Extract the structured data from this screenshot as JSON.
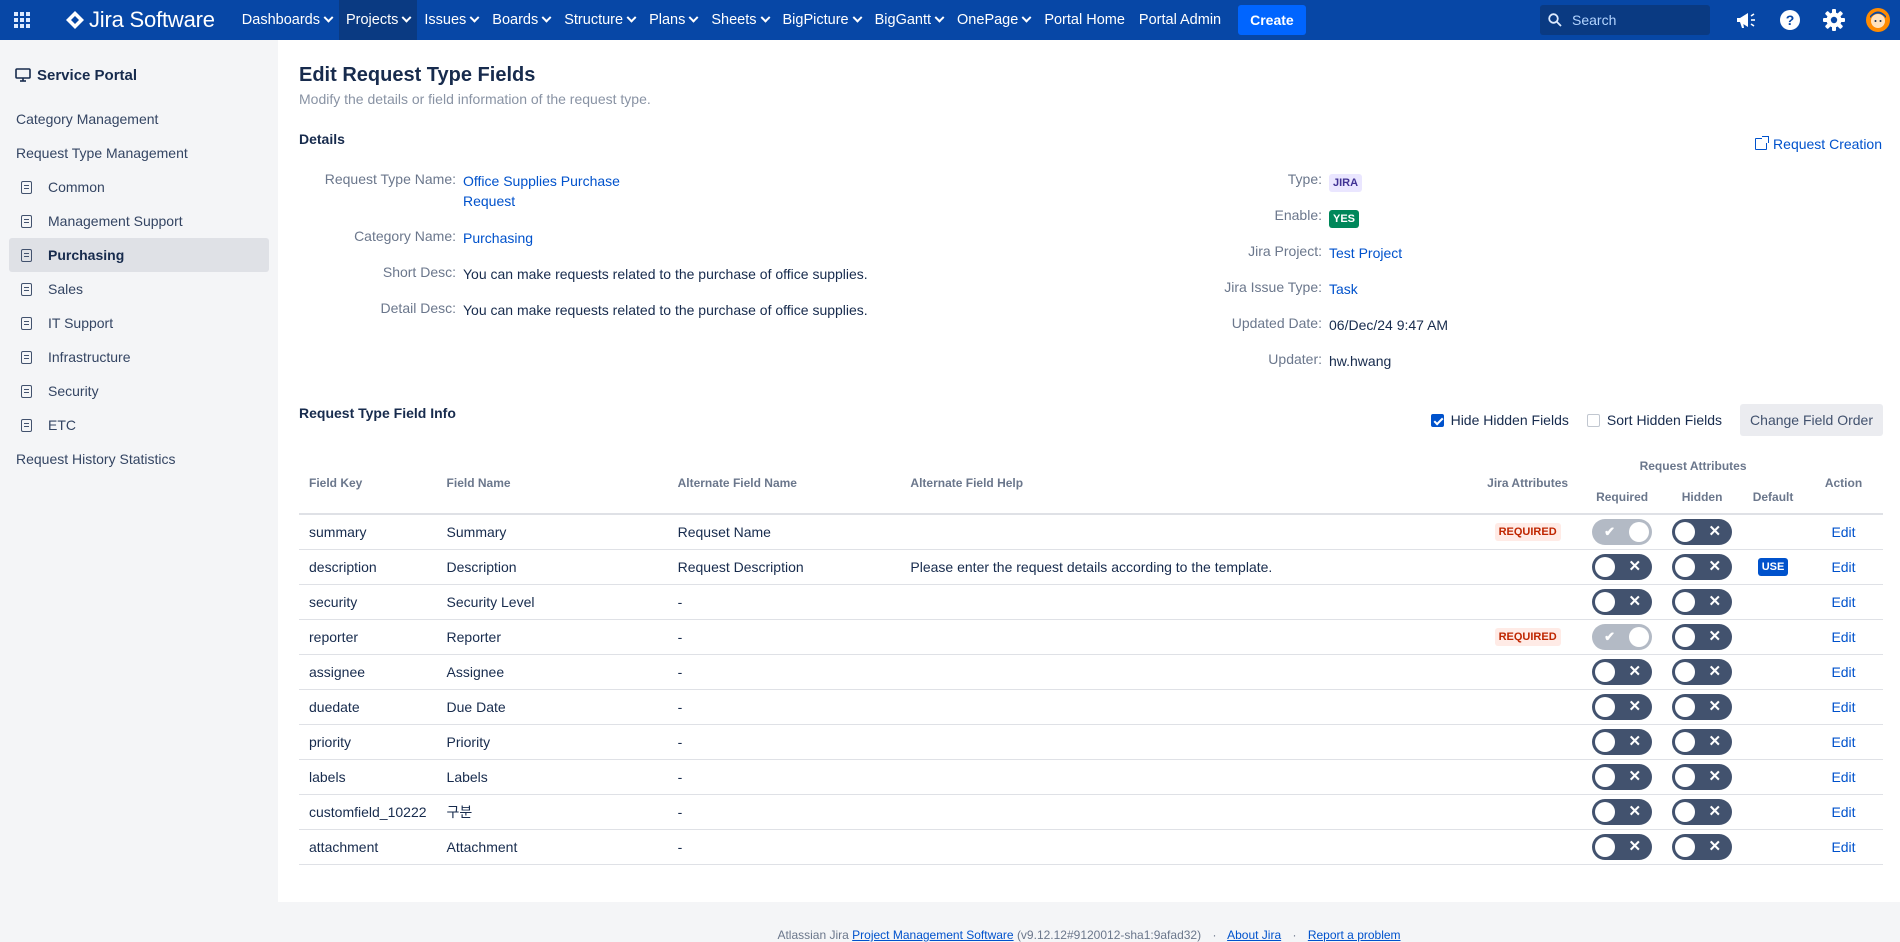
{
  "topnav": {
    "logo_text": "Jira Software",
    "items": [
      {
        "label": "Dashboards",
        "dropdown": true
      },
      {
        "label": "Projects",
        "dropdown": true,
        "active": true
      },
      {
        "label": "Issues",
        "dropdown": true
      },
      {
        "label": "Boards",
        "dropdown": true
      },
      {
        "label": "Structure",
        "dropdown": true
      },
      {
        "label": "Plans",
        "dropdown": true
      },
      {
        "label": "Sheets",
        "dropdown": true
      },
      {
        "label": "BigPicture",
        "dropdown": true
      },
      {
        "label": "BigGantt",
        "dropdown": true
      },
      {
        "label": "OnePage",
        "dropdown": true
      },
      {
        "label": "Portal Home",
        "dropdown": false
      },
      {
        "label": "Portal Admin",
        "dropdown": false
      }
    ],
    "create_label": "Create",
    "search_placeholder": "Search",
    "icons": [
      "app-switcher-icon",
      "notifications-megaphone-icon",
      "help-icon",
      "settings-gear-icon",
      "user-avatar"
    ],
    "colors": {
      "bar": "#0747a6",
      "create": "#0065ff"
    }
  },
  "sidebar": {
    "title": "Service Portal",
    "category_management": "Category Management",
    "request_type_management": "Request Type Management",
    "items": [
      {
        "label": "Common"
      },
      {
        "label": "Management Support"
      },
      {
        "label": "Purchasing",
        "active": true
      },
      {
        "label": "Sales"
      },
      {
        "label": "IT Support"
      },
      {
        "label": "Infrastructure"
      },
      {
        "label": "Security"
      },
      {
        "label": "ETC"
      }
    ],
    "history": "Request History Statistics"
  },
  "page": {
    "title": "Edit Request Type Fields",
    "subtitle": "Modify the details or field information of the request type.",
    "details_heading": "Details",
    "request_creation_link": "Request Creation",
    "details_left": {
      "request_type_name_label": "Request Type Name:",
      "request_type_name": "Office Supplies Purchase Request",
      "category_name_label": "Category Name:",
      "category_name": "Purchasing",
      "short_desc_label": "Short Desc:",
      "short_desc": "You can make requests related to the purchase of office supplies.",
      "detail_desc_label": "Detail Desc:",
      "detail_desc": "You can make requests related to the purchase of office supplies."
    },
    "details_right": {
      "type_label": "Type:",
      "type": "JIRA",
      "enable_label": "Enable:",
      "enable": "YES",
      "jira_project_label": "Jira Project:",
      "jira_project": "Test Project",
      "jira_issue_type_label": "Jira Issue Type:",
      "jira_issue_type": "Task",
      "updated_date_label": "Updated Date:",
      "updated_date": "06/Dec/24 9:47 AM",
      "updater_label": "Updater:",
      "updater": "hw.hwang"
    },
    "field_info_heading": "Request Type Field Info",
    "hide_hidden_fields": {
      "label": "Hide Hidden Fields",
      "checked": true
    },
    "sort_hidden_fields": {
      "label": "Sort Hidden Fields",
      "checked": false
    },
    "change_field_order": "Change Field Order"
  },
  "table": {
    "headers": {
      "field_key": "Field Key",
      "field_name": "Field Name",
      "alternate_field_name": "Alternate Field Name",
      "alternate_field_help": "Alternate Field Help",
      "jira_attributes": "Jira Attributes",
      "request_attributes": "Request Attributes",
      "required": "Required",
      "hidden": "Hidden",
      "default": "Default",
      "action": "Action"
    },
    "rows": [
      {
        "key": "summary",
        "name": "Summary",
        "alt_name": "Requset Name",
        "alt_help": "",
        "jira_attr": "REQUIRED",
        "required": "locked-on",
        "hidden": "off",
        "default": "",
        "action": "Edit"
      },
      {
        "key": "description",
        "name": "Description",
        "alt_name": "Request Description",
        "alt_help": "Please enter the request details according to the template.",
        "jira_attr": "",
        "required": "off",
        "hidden": "off",
        "default": "USE",
        "action": "Edit"
      },
      {
        "key": "security",
        "name": "Security Level",
        "alt_name": "-",
        "alt_help": "",
        "jira_attr": "",
        "required": "off",
        "hidden": "off",
        "default": "",
        "action": "Edit"
      },
      {
        "key": "reporter",
        "name": "Reporter",
        "alt_name": "-",
        "alt_help": "",
        "jira_attr": "REQUIRED",
        "required": "locked-on",
        "hidden": "off",
        "default": "",
        "action": "Edit"
      },
      {
        "key": "assignee",
        "name": "Assignee",
        "alt_name": "-",
        "alt_help": "",
        "jira_attr": "",
        "required": "off",
        "hidden": "off",
        "default": "",
        "action": "Edit"
      },
      {
        "key": "duedate",
        "name": "Due Date",
        "alt_name": "-",
        "alt_help": "",
        "jira_attr": "",
        "required": "off",
        "hidden": "off",
        "default": "",
        "action": "Edit"
      },
      {
        "key": "priority",
        "name": "Priority",
        "alt_name": "-",
        "alt_help": "",
        "jira_attr": "",
        "required": "off",
        "hidden": "off",
        "default": "",
        "action": "Edit"
      },
      {
        "key": "labels",
        "name": "Labels",
        "alt_name": "-",
        "alt_help": "",
        "jira_attr": "",
        "required": "off",
        "hidden": "off",
        "default": "",
        "action": "Edit"
      },
      {
        "key": "customfield_10222",
        "name": "구분",
        "alt_name": "-",
        "alt_help": "",
        "jira_attr": "",
        "required": "off",
        "hidden": "off",
        "default": "",
        "action": "Edit"
      },
      {
        "key": "attachment",
        "name": "Attachment",
        "alt_name": "-",
        "alt_help": "",
        "jira_attr": "",
        "required": "off",
        "hidden": "off",
        "default": "",
        "action": "Edit"
      }
    ]
  },
  "footer": {
    "prefix": "Atlassian Jira",
    "pms_link": "Project Management Software",
    "version": "(v9.12.12#9120012-sha1:9afad32)",
    "about": "About Jira",
    "report": "Report a problem"
  }
}
